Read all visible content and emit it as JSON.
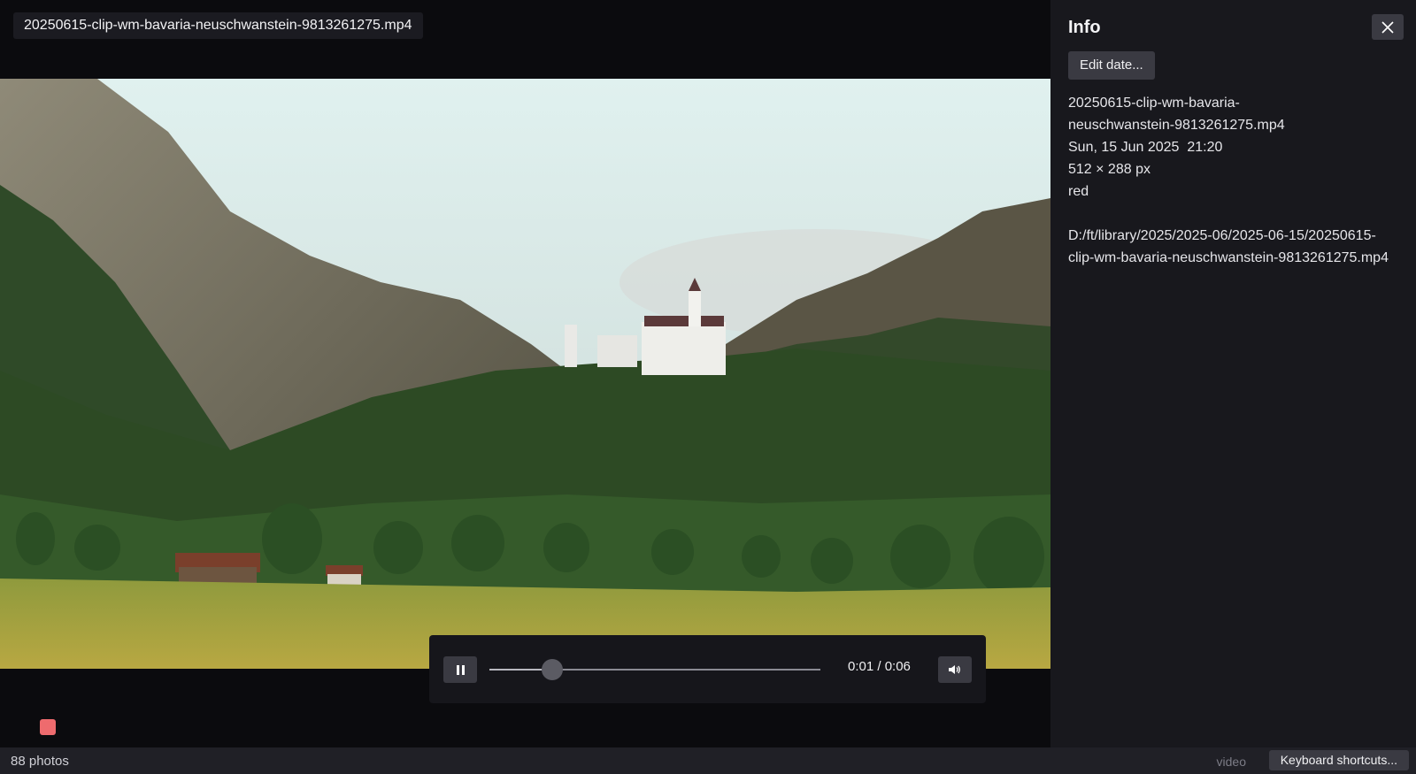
{
  "viewer": {
    "filename": "20250615-clip-wm-bavaria-neuschwanstein-9813261275.mp4"
  },
  "player": {
    "state": "playing",
    "pause_icon": "pause-icon",
    "volume_icon": "speaker-icon",
    "time_label": "0:01 / 0:06",
    "progress_fraction": 0.19
  },
  "color_label": {
    "value": "red",
    "color": "#ee6b6e"
  },
  "info_panel": {
    "title": "Info",
    "close_icon": "close-icon",
    "edit_date_label": "Edit date...",
    "filename_line1": "20250615-clip-wm-bavaria-",
    "filename_line2": "neuschwanstein-9813261275.mp4",
    "date": "Sun, 15 Jun 2025  21:20",
    "dimensions": "512 × 288 px",
    "color_label": "red",
    "path_line1": "D:/ft/library/2025/2025-06/2025-06-15/20250615-",
    "path_line2": "clip-wm-bavaria-neuschwanstein-9813261275.mp4"
  },
  "status_bar": {
    "photo_count": "88 photos",
    "media_type": "video",
    "shortcuts_label": "Keyboard shortcuts..."
  }
}
